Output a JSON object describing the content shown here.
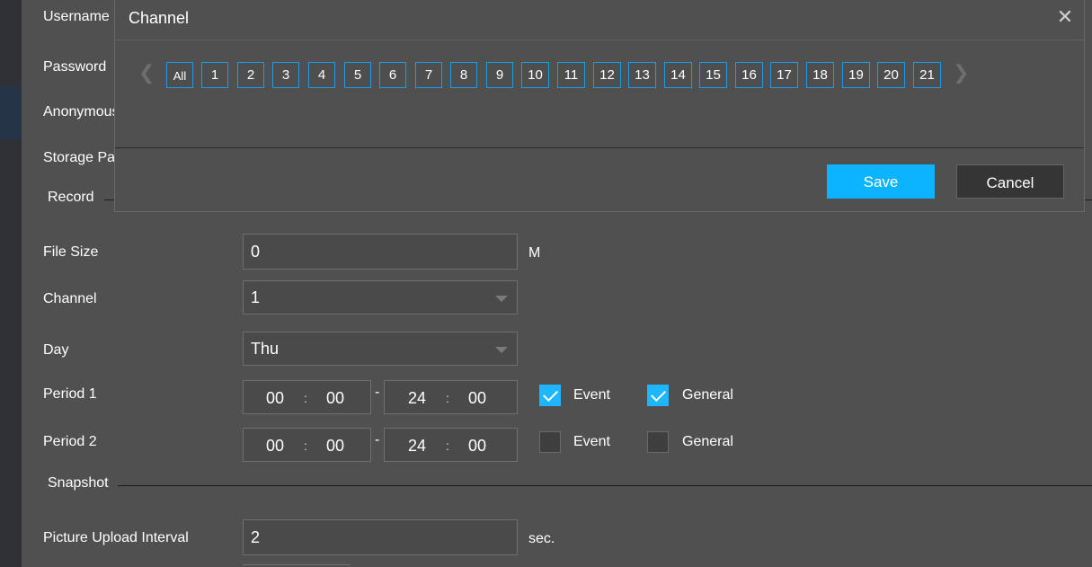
{
  "background_form": {
    "top_labels": {
      "username": "Username",
      "password": "Password",
      "anonymous": "Anonymous",
      "storage_path": "Storage Pa"
    },
    "record_section": "Record",
    "file_size": {
      "label": "File Size",
      "value": "0",
      "unit": "M"
    },
    "channel": {
      "label": "Channel",
      "value": "1"
    },
    "day": {
      "label": "Day",
      "value": "Thu"
    },
    "period1": {
      "label": "Period 1",
      "start_h": "00",
      "start_m": "00",
      "end_h": "24",
      "end_m": "00",
      "event_label": "Event",
      "event_checked": true,
      "general_label": "General",
      "general_checked": true
    },
    "period2": {
      "label": "Period 2",
      "start_h": "00",
      "start_m": "00",
      "end_h": "24",
      "end_m": "00",
      "event_label": "Event",
      "event_checked": false,
      "general_label": "General",
      "general_checked": false
    },
    "time_colon": ":",
    "time_dash": "-",
    "snapshot_section": "Snapshot",
    "picture_upload_interval": {
      "label": "Picture Upload Interval",
      "value": "2",
      "unit": "sec."
    }
  },
  "modal": {
    "title": "Channel",
    "close_glyph": "✕",
    "prev_glyph": "❮",
    "next_glyph": "❯",
    "channels": [
      "All",
      "1",
      "2",
      "3",
      "4",
      "5",
      "6",
      "7",
      "8",
      "9",
      "10",
      "11",
      "12",
      "13",
      "14",
      "15",
      "16",
      "17",
      "18",
      "19",
      "20",
      "21"
    ],
    "save_label": "Save",
    "cancel_label": "Cancel"
  },
  "colors": {
    "accent": "#0cb4ff",
    "channel_border": "#1e9be8",
    "background": "#505050"
  }
}
